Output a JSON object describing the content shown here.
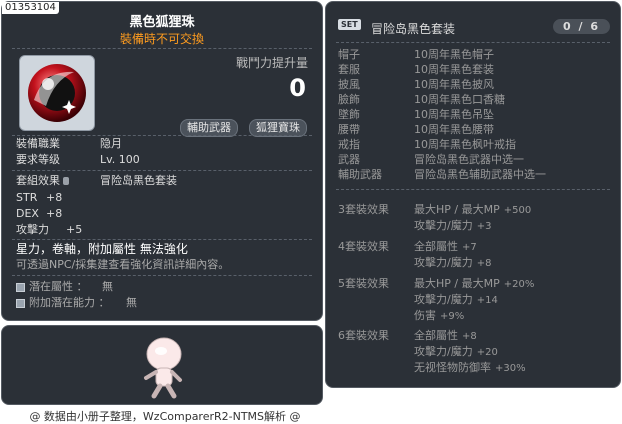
{
  "item": {
    "id": "01353104",
    "name": "黑色狐狸珠",
    "subtitle": "裝備時不可交換",
    "power_label": "戰鬥力提升量",
    "power_value": "0",
    "tags": [
      "輔助武器",
      "狐狸寶珠"
    ],
    "job_label": "裝備職業",
    "job_value": "隐月",
    "level_label": "要求等级",
    "level_value": "Lv. 100",
    "set_label": "套組效果",
    "set_value": "冒险岛黑色套装",
    "stats": [
      {
        "name": "STR",
        "value": "+8"
      },
      {
        "name": "DEX",
        "value": "+8"
      },
      {
        "name": "攻擊力",
        "value": "+5"
      }
    ],
    "note1": "星力，卷軸，附加屬性 無法強化",
    "note2": "可透過NPC/採集建查看強化資訊詳細內容。",
    "potential_label": "潛在屬性 ：",
    "potential_value": "無",
    "add_potential_label": "附加潛在能力 ：",
    "add_potential_value": "無"
  },
  "set": {
    "tag": "SET",
    "title": "冒险岛黑色套装",
    "count": "0 / 6",
    "parts": [
      {
        "slot": "帽子",
        "name": "10周年黑色帽子"
      },
      {
        "slot": "套服",
        "name": "10周年黑色套装"
      },
      {
        "slot": "披風",
        "name": "10周年黑色披风"
      },
      {
        "slot": "臉飾",
        "name": "10周年黑色口香糖"
      },
      {
        "slot": "墜飾",
        "name": "10周年黑色吊坠"
      },
      {
        "slot": "腰帶",
        "name": "10周年黑色腰带"
      },
      {
        "slot": "戒指",
        "name": "10周年黑色枫叶戒指"
      },
      {
        "slot": "武器",
        "name": "冒险岛黑色武器中选一"
      },
      {
        "slot": "輔助武器",
        "name": "冒险岛黑色辅助武器中选一"
      }
    ],
    "effects": [
      {
        "label": "3套裝效果",
        "lines": [
          {
            "text": "最大HP / 最大MP",
            "val": "+500"
          },
          {
            "text": "攻擊力/魔力",
            "val": "+3"
          }
        ]
      },
      {
        "label": "4套裝效果",
        "lines": [
          {
            "text": "全部屬性",
            "val": "+7"
          },
          {
            "text": "攻擊力/魔力",
            "val": "+8"
          }
        ]
      },
      {
        "label": "5套裝效果",
        "lines": [
          {
            "text": "最大HP / 最大MP",
            "val": "+20%"
          },
          {
            "text": "攻擊力/魔力",
            "val": "+14"
          },
          {
            "text": "伤害",
            "val": "+9%"
          }
        ]
      },
      {
        "label": "6套裝效果",
        "lines": [
          {
            "text": "全部屬性",
            "val": "+8"
          },
          {
            "text": "攻擊力/魔力",
            "val": "+20"
          },
          {
            "text": "无视怪物防御率",
            "val": "+30%"
          }
        ]
      }
    ]
  },
  "footer": "@ 数据由小册子整理，WzComparerR2-NTMS解析 @",
  "colors": {
    "panel": "#2b3037",
    "accent": "#ff9c1f"
  }
}
